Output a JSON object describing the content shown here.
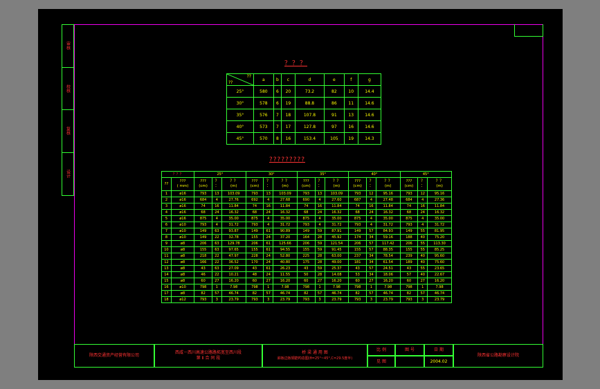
{
  "left_strip": [
    "审核",
    "校核",
    "复核",
    "设计"
  ],
  "table1": {
    "title": "？？？",
    "corner_top": "??",
    "corner_bottom": "??",
    "columns": [
      "a",
      "b",
      "c",
      "d",
      "e",
      "f",
      "g"
    ],
    "rows": [
      {
        "label": "25°",
        "values": [
          "580",
          "6",
          "20",
          "73.2",
          "82",
          "10",
          "14.4"
        ]
      },
      {
        "label": "30°",
        "values": [
          "578",
          "6",
          "19",
          "88.8",
          "86",
          "11",
          "14.6"
        ]
      },
      {
        "label": "35°",
        "values": [
          "576",
          "7",
          "18",
          "107.8",
          "91",
          "13",
          "14.6"
        ]
      },
      {
        "label": "40°",
        "values": [
          "573",
          "7",
          "17",
          "127.8",
          "97",
          "16",
          "14.6"
        ]
      },
      {
        "label": "45°",
        "values": [
          "570",
          "8",
          "16",
          "153.4",
          "105",
          "19",
          "14.3"
        ]
      }
    ]
  },
  "table2": {
    "title": "?????????",
    "corner": "？？？",
    "angles": [
      "25°",
      "30°",
      "35°",
      "40°",
      "45°"
    ],
    "sub_headers": {
      "no": "??",
      "dia": "???\n( mm)",
      "len": "???\n(cm)",
      "cnt": "？\n：",
      "tot": "？？\n(m)"
    },
    "rows": [
      [
        "1",
        "ø16",
        "793",
        "13",
        "103.09",
        "793",
        "13",
        "103.09",
        "793",
        "13",
        "103.09",
        "793",
        "12",
        "95.16",
        "793",
        "12",
        "95.16"
      ],
      [
        "2",
        "ø16",
        "684",
        "4",
        "27.76",
        "692",
        "4",
        "27.68",
        "690",
        "4",
        "27.60",
        "687",
        "4",
        "27.48",
        "684",
        "4",
        "27.36"
      ],
      [
        "3",
        "ø16",
        "74",
        "16",
        "11.84",
        "74",
        "16",
        "11.84",
        "74",
        "16",
        "11.84",
        "74",
        "16",
        "11.84",
        "74",
        "16",
        "11.84"
      ],
      [
        "4",
        "ø16",
        "68",
        "24",
        "16.32",
        "68",
        "24",
        "16.32",
        "68",
        "24",
        "16.32",
        "68",
        "24",
        "16.32",
        "68",
        "24",
        "16.32"
      ],
      [
        "5",
        "ø16",
        "875",
        "4",
        "35.00",
        "875",
        "4",
        "35.00",
        "875",
        "4",
        "35.00",
        "875",
        "4",
        "35.00",
        "875",
        "4",
        "35.00"
      ],
      [
        "6",
        "ø10",
        "793",
        "4",
        "31.72",
        "793",
        "4",
        "31.72",
        "793",
        "4",
        "31.72",
        "793",
        "4",
        "31.72",
        "793",
        "4",
        "31.72"
      ],
      [
        "7",
        "ø10",
        "149",
        "63",
        "93.87",
        "149",
        "61",
        "90.89",
        "149",
        "59",
        "87.91",
        "149",
        "57",
        "84.93",
        "149",
        "55",
        "81.95"
      ],
      [
        "8",
        "ø10",
        "149",
        "22",
        "32.78",
        "155",
        "24",
        "37.20",
        "164",
        "28",
        "45.92",
        "174",
        "34",
        "59.16",
        "188",
        "40",
        "75.20"
      ],
      [
        "9",
        "ø8",
        "206",
        "63",
        "129.78",
        "206",
        "61",
        "125.66",
        "206",
        "59",
        "121.54",
        "206",
        "57",
        "117.42",
        "206",
        "55",
        "113.30"
      ],
      [
        "10",
        "ø8",
        "155",
        "63",
        "97.65",
        "155",
        "61",
        "94.55",
        "155",
        "59",
        "91.45",
        "155",
        "57",
        "88.35",
        "155",
        "55",
        "85.25"
      ],
      [
        "11",
        "ø8",
        "218",
        "22",
        "47.97",
        "228",
        "24",
        "52.80",
        "225",
        "28",
        "63.00",
        "237",
        "34",
        "78.54",
        "239",
        "40",
        "95.60"
      ],
      [
        "12",
        "ø8",
        "166",
        "22",
        "36.52",
        "170",
        "24",
        "40.80",
        "175",
        "28",
        "49.00",
        "181",
        "34",
        "61.54",
        "189",
        "40",
        "75.60"
      ],
      [
        "13",
        "ø8",
        "43",
        "63",
        "27.09",
        "43",
        "61",
        "26.23",
        "43",
        "59",
        "25.37",
        "43",
        "57",
        "24.51",
        "43",
        "55",
        "23.65"
      ],
      [
        "14",
        "ø8",
        "46",
        "22",
        "10.21",
        "48",
        "24",
        "11.55",
        "50",
        "28",
        "14.08",
        "53",
        "34",
        "18.06",
        "57",
        "40",
        "22.67"
      ],
      [
        "15",
        "ø8",
        "60",
        "27",
        "16.20",
        "60",
        "27",
        "16.20",
        "60",
        "27",
        "16.20",
        "60",
        "27",
        "16.20",
        "60",
        "27",
        "16.20"
      ],
      [
        "16",
        "ø10",
        "798",
        "1",
        "7.98",
        "798",
        "1",
        "7.98",
        "798",
        "1",
        "7.98",
        "798",
        "1",
        "7.98",
        "798",
        "1",
        "7.98"
      ],
      [
        "17",
        "ø8",
        "82",
        "57",
        "46.74",
        "82",
        "57",
        "46.74",
        "82",
        "57",
        "46.74",
        "82",
        "57",
        "46.74",
        "82",
        "57",
        "46.74"
      ],
      [
        "18",
        "ø12",
        "793",
        "3",
        "23.79",
        "793",
        "3",
        "23.79",
        "793",
        "3",
        "23.79",
        "793",
        "3",
        "23.79",
        "793",
        "3",
        "23.79"
      ]
    ]
  },
  "title_block": {
    "company": "陕西交通资产经营有限公司",
    "project_line1": "西咸－西川高速公路路拓宽至西川段",
    "project_line2": "第 Ⅱ 合 同 段",
    "drawing_name_line1": "桥 梁 通 用 图",
    "drawing_name_line2": "斜板边板钢筋构造图(θ=25°~45°,C=29.5度半)",
    "scale_label": "比 例",
    "scale_value": "见 图",
    "sheet_label": "图 号",
    "date_label": "日 期",
    "date_value": "2004.02",
    "designer": "陕西省公路勘察设计院"
  }
}
